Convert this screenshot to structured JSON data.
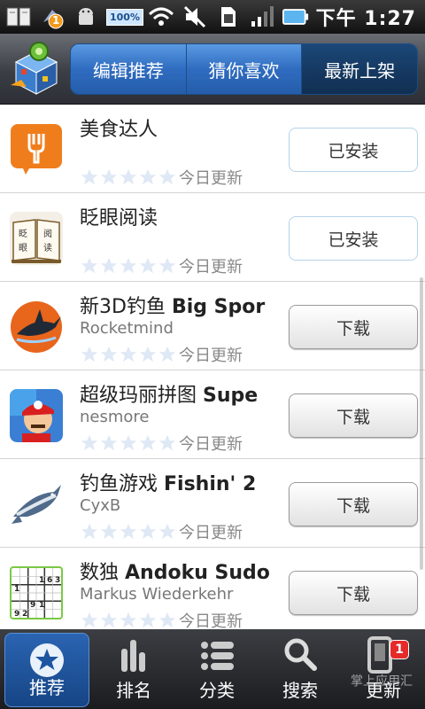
{
  "status_bar": {
    "notification_count": "1",
    "battery": "100%",
    "time": "下午 1:27"
  },
  "header": {
    "tabs": [
      {
        "label": "编辑推荐",
        "active": false
      },
      {
        "label": "猜你喜欢",
        "active": false
      },
      {
        "label": "最新上架",
        "active": true
      }
    ]
  },
  "apps": [
    {
      "name": "美食达人",
      "name_en": "",
      "developer": "",
      "rating": 0,
      "updated": "今日更新",
      "action": "已安装",
      "state": "installed",
      "icon": "fork-icon"
    },
    {
      "name": "眨眼阅读",
      "name_en": "",
      "developer": "",
      "rating": 0,
      "updated": "今日更新",
      "action": "已安装",
      "state": "installed",
      "icon": "book-icon"
    },
    {
      "name": "新3D钓鱼",
      "name_en": "Big Spor",
      "developer": "Rocketmind",
      "rating": 0,
      "updated": "今日更新",
      "action": "下载",
      "state": "download",
      "icon": "marlin-icon"
    },
    {
      "name": "超级玛丽拼图",
      "name_en": "Supe",
      "developer": "nesmore",
      "rating": 0,
      "updated": "今日更新",
      "action": "下载",
      "state": "download",
      "icon": "mario-icon"
    },
    {
      "name": "钓鱼游戏",
      "name_en": "Fishin' 2",
      "developer": "CyxB",
      "rating": 0,
      "updated": "今日更新",
      "action": "下载",
      "state": "download",
      "icon": "tuna-icon"
    },
    {
      "name": "数独",
      "name_en": "Andoku Sudo",
      "developer": "Markus Wiederkehr",
      "rating": 0,
      "updated": "今日更新",
      "action": "下载",
      "state": "download",
      "icon": "sudoku-icon"
    }
  ],
  "sudoku_digits": [
    "1",
    "6",
    "3",
    "9",
    "1",
    "9",
    "2",
    "1"
  ],
  "bottom_nav": {
    "items": [
      {
        "label": "推荐",
        "icon": "star-icon",
        "active": true
      },
      {
        "label": "排名",
        "icon": "bars-icon",
        "active": false
      },
      {
        "label": "分类",
        "icon": "list-icon",
        "active": false
      },
      {
        "label": "搜索",
        "icon": "search-icon",
        "active": false
      },
      {
        "label": "更新",
        "icon": "update-icon",
        "active": false,
        "badge": "1"
      }
    ],
    "watermark": "掌上应用汇"
  },
  "colors": {
    "tab_blue": "#2f6cc0",
    "tab_active": "#163a63",
    "nav_active": "#2a64b2",
    "badge_red": "#e52a2a"
  }
}
